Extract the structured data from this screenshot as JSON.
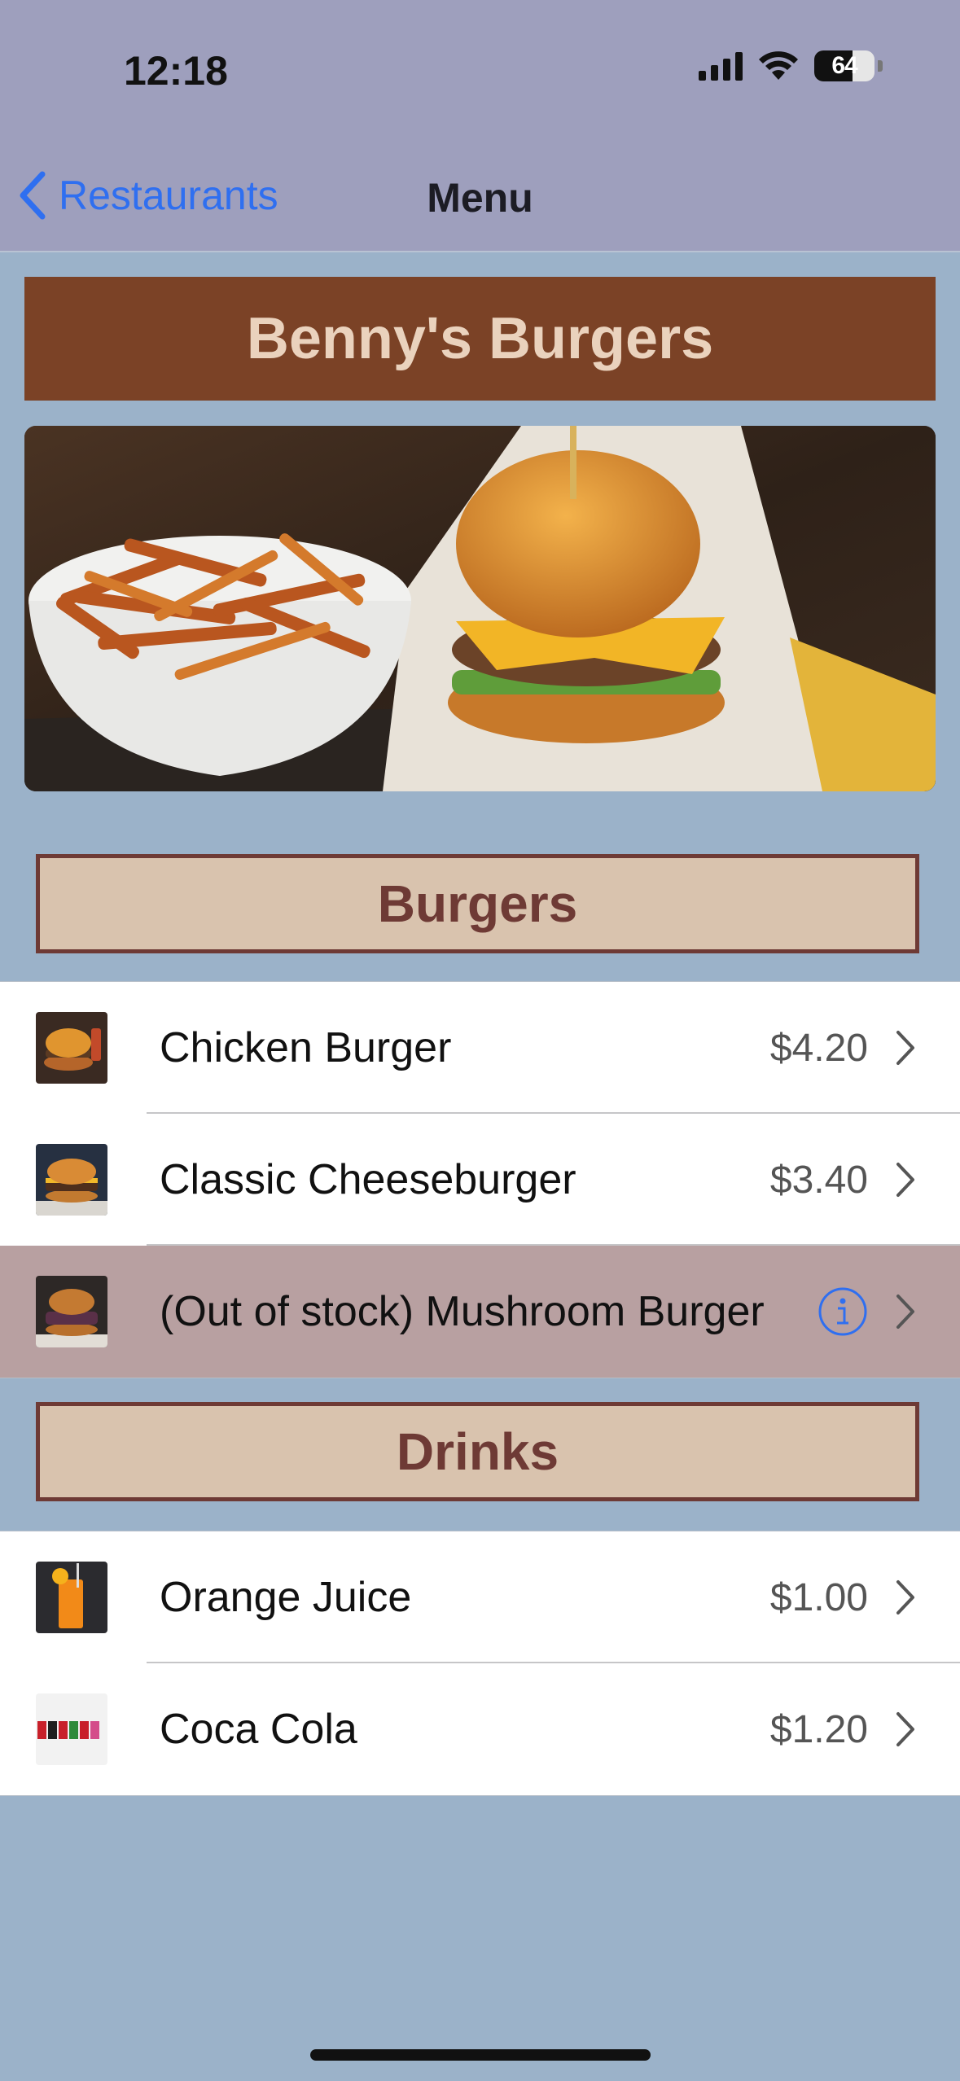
{
  "status_bar": {
    "time": "12:18",
    "battery": "64"
  },
  "nav": {
    "back_label": "Restaurants",
    "title": "Menu"
  },
  "restaurant": {
    "name": "Benny's Burgers"
  },
  "sections": [
    {
      "title": "Burgers",
      "items": [
        {
          "name": "Chicken Burger",
          "price": "$4.20",
          "out_of_stock": false
        },
        {
          "name": "Classic Cheeseburger",
          "price": "$3.40",
          "out_of_stock": false
        },
        {
          "name": "(Out of stock) Mushroom Burger",
          "price": "",
          "out_of_stock": true
        }
      ]
    },
    {
      "title": "Drinks",
      "items": [
        {
          "name": "Orange Juice",
          "price": "$1.00",
          "out_of_stock": false
        },
        {
          "name": "Coca Cola",
          "price": "$1.20",
          "out_of_stock": false
        }
      ]
    }
  ],
  "colors": {
    "background": "#9bb2c9",
    "nav_bar": "#9e9fbd",
    "banner": "#7b4226",
    "section_header": "#d9c3ae",
    "section_border": "#6e3a35",
    "out_of_stock_row": "#b8a0a1",
    "link": "#2f6ff0"
  }
}
